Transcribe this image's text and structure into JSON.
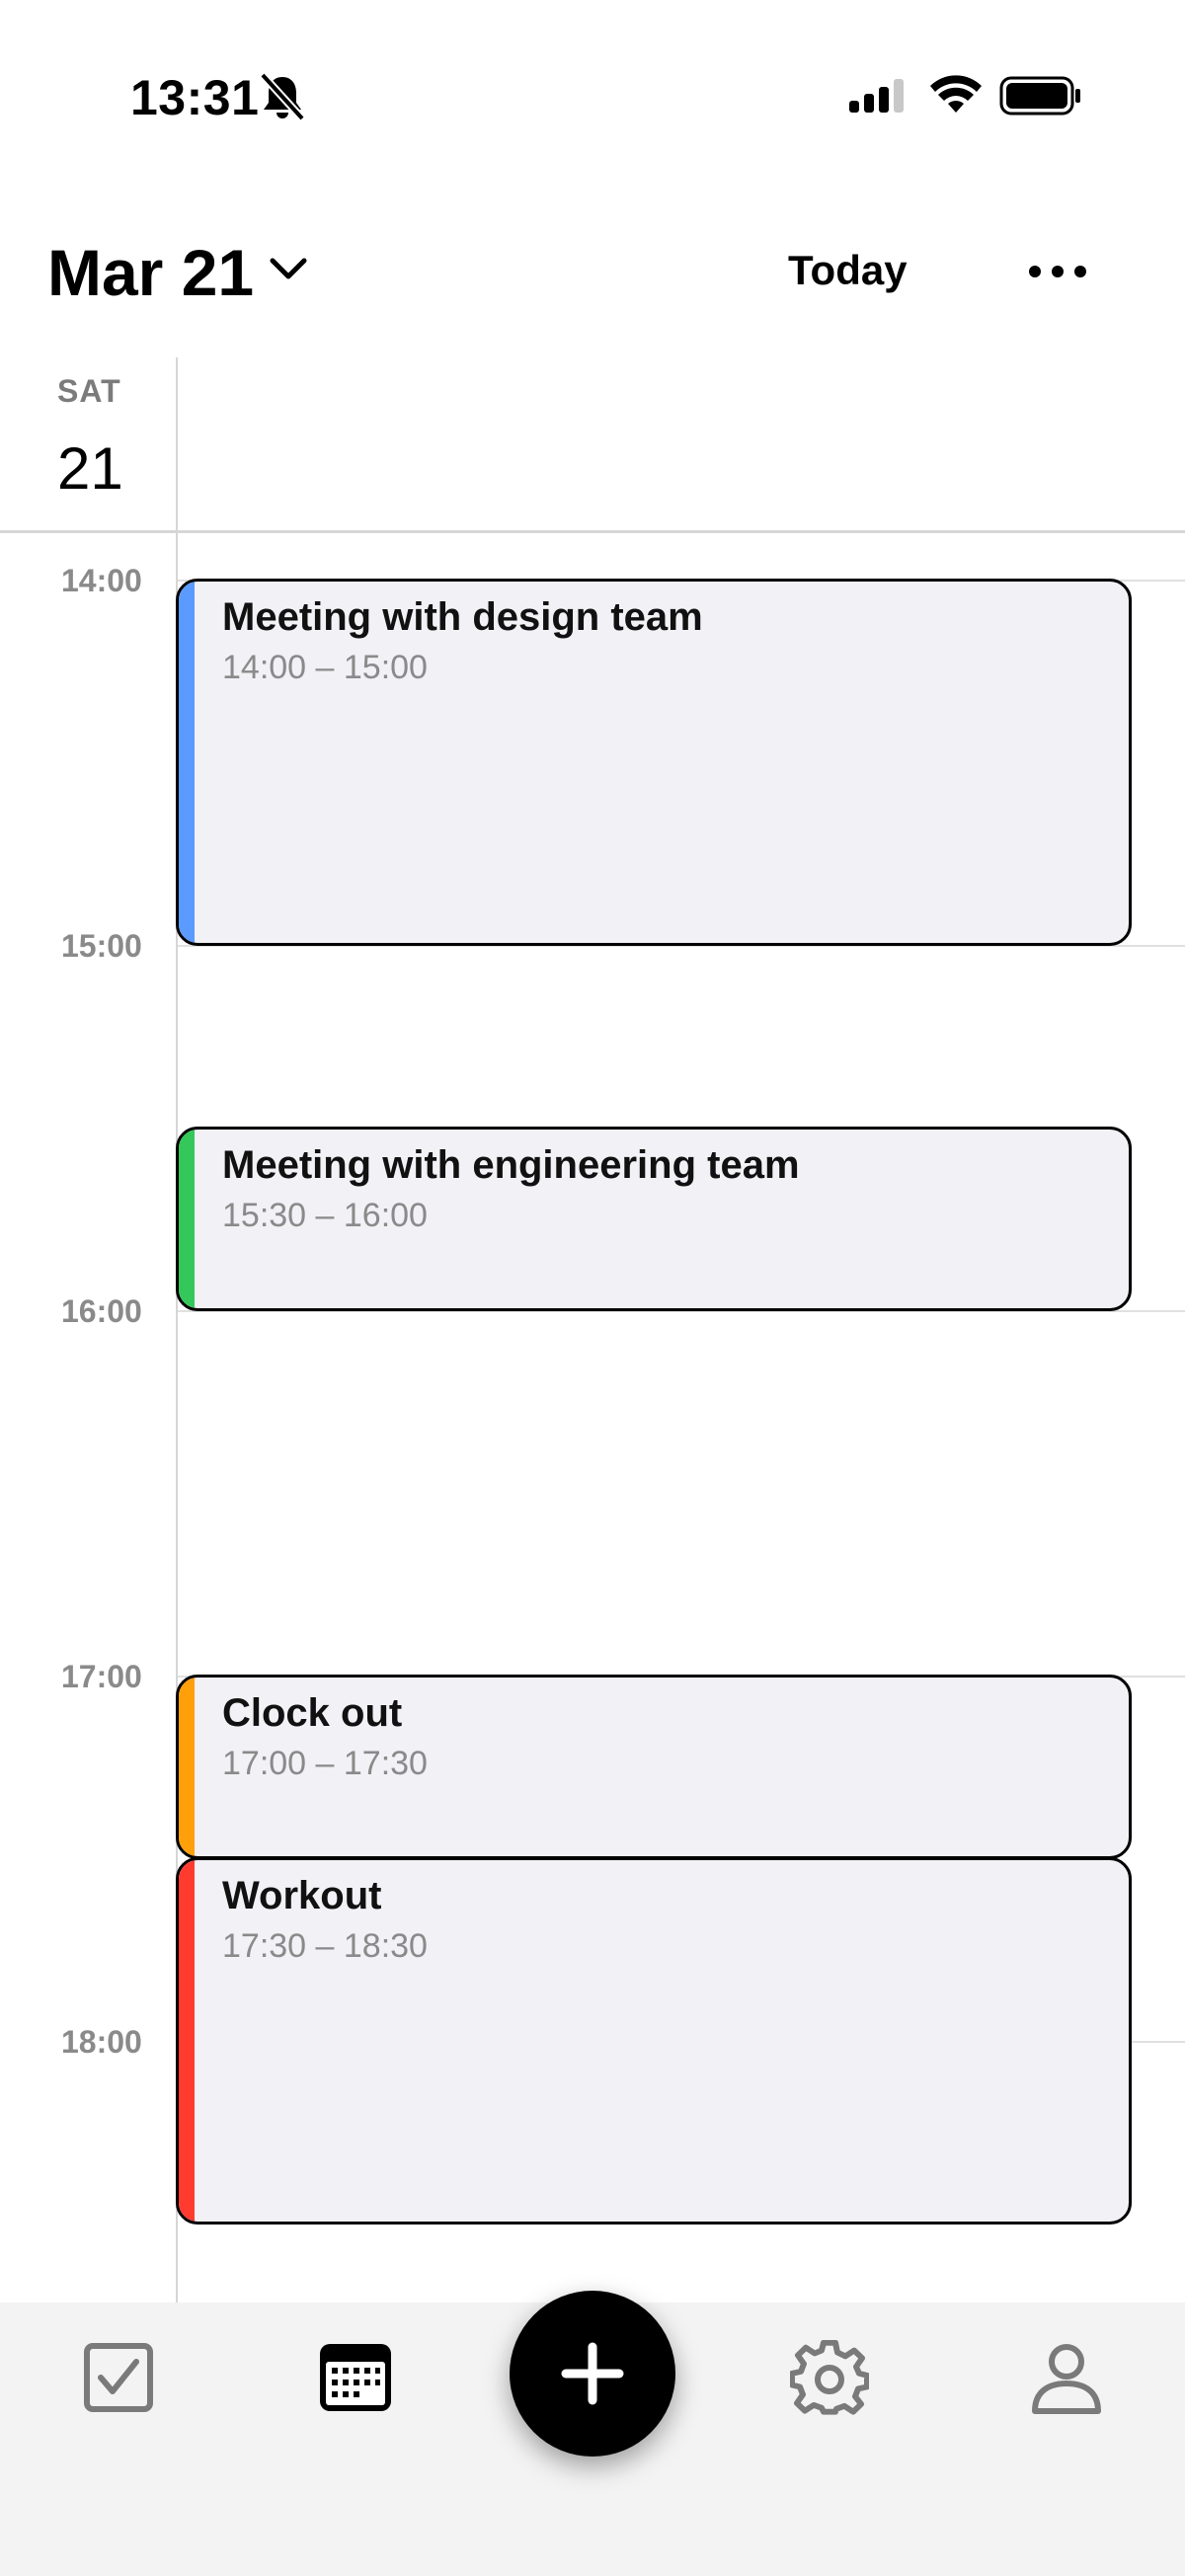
{
  "status_bar": {
    "time": "13:31"
  },
  "header": {
    "date": "Mar 21",
    "today_label": "Today"
  },
  "day": {
    "name": "SAT",
    "number": "21"
  },
  "hours": [
    "14:00",
    "15:00",
    "16:00",
    "17:00",
    "18:00"
  ],
  "events": [
    {
      "title": "Meeting with design team",
      "time": "14:00 – 15:00",
      "color": "#5b9aff"
    },
    {
      "title": "Meeting with engineering team",
      "time": "15:30 – 16:00",
      "color": "#34c759"
    },
    {
      "title": "Clock out",
      "time": "17:00 – 17:30",
      "color": "#ff9f0a"
    },
    {
      "title": "Workout",
      "time": "17:30 – 18:30",
      "color": "#ff3b30"
    }
  ],
  "nav": {
    "items": [
      "tasks-icon",
      "calendar-icon",
      "add-icon",
      "settings-icon",
      "profile-icon"
    ],
    "active": "calendar-icon"
  },
  "colors": {
    "background": "#ffffff",
    "event_bg": "#f1f1f6",
    "fab": "#000000"
  }
}
